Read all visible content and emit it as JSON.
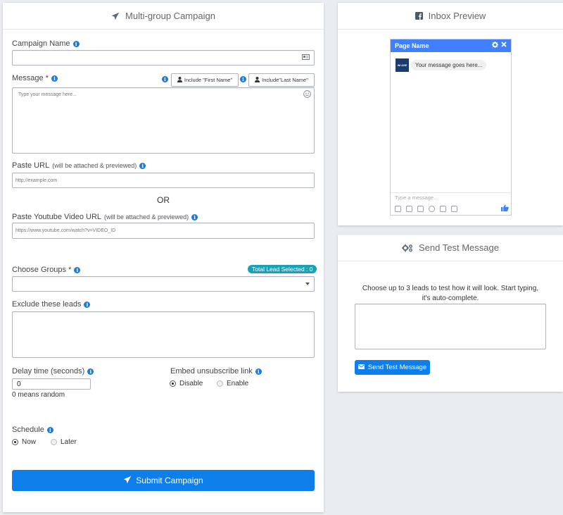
{
  "campaign": {
    "title": "Multi-group Campaign",
    "campaign_name_label": "Campaign Name",
    "message_label": "Message *",
    "include_first_name": "Include \"First Name\"",
    "include_last_name": "Include\"Last Name\"",
    "message_placeholder": "Type your message here...",
    "paste_url_label": "Paste URL",
    "paste_url_note": "(will be attached & previewed)",
    "paste_url_placeholder": "http://example.com",
    "or_text": "OR",
    "youtube_label": "Paste Youtube Video URL",
    "youtube_note": "(will be attached & previewed)",
    "youtube_placeholder": "https://www.youtube.com/watch?v=VIDEO_ID",
    "choose_groups_label": "Choose Groups *",
    "total_lead_badge": "Total Lead Selected : 0",
    "exclude_label": "Exclude these leads",
    "delay_label": "Delay time (seconds)",
    "delay_value": "0",
    "delay_note": "0 means random",
    "embed_label": "Embed unsubscribe link",
    "embed_options": [
      "Disable",
      "Enable"
    ],
    "embed_selected": "Disable",
    "schedule_label": "Schedule",
    "schedule_options": [
      "Now",
      "Later"
    ],
    "schedule_selected": "Now",
    "submit_label": "Submit Campaign"
  },
  "inbox": {
    "title": "Inbox Preview",
    "page_name": "Page Name",
    "avatar_text": "IM ASE",
    "bubble_text": "Your message goes here...",
    "input_placeholder": "Type a message..."
  },
  "test": {
    "title": "Send Test Message",
    "description": "Choose up to 3 leads to test how it will look. Start typing, it's auto-complete.",
    "button_label": "Send Test Message"
  },
  "colors": {
    "primary": "#0d7eea",
    "info": "#1f7ad1",
    "badge": "#17a2b8",
    "messenger": "#4080ff"
  }
}
